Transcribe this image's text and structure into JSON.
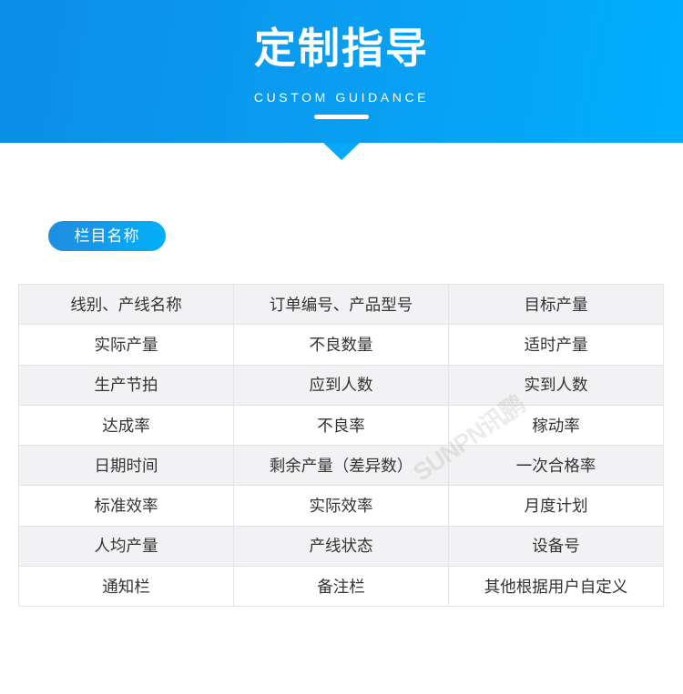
{
  "banner": {
    "title": "定制指导",
    "subtitle": "CUSTOM GUIDANCE",
    "gradient_start": "#0b90e8",
    "gradient_end": "#00aeff",
    "arrow_color": "#07a8fa",
    "text_color": "#ffffff"
  },
  "section": {
    "badge_label": "栏目名称",
    "badge_gradient_start": "#1e8fe0",
    "badge_gradient_end": "#00b0f5"
  },
  "table": {
    "columns": 3,
    "row_shaded_color": "#f2f2f4",
    "row_plain_color": "#ffffff",
    "border_color": "#e3e4e6",
    "text_color": "#333333",
    "rows": [
      [
        "线别、产线名称",
        "订单编号、产品型号",
        "目标产量"
      ],
      [
        "实际产量",
        "不良数量",
        "适时产量"
      ],
      [
        "生产节拍",
        "应到人数",
        "实到人数"
      ],
      [
        "达成率",
        "不良率",
        "稼动率"
      ],
      [
        "日期时间",
        "剩余产量（差异数）",
        "一次合格率"
      ],
      [
        "标准效率",
        "实际效率",
        "月度计划"
      ],
      [
        "人均产量",
        "产线状态",
        "设备号"
      ],
      [
        "通知栏",
        "备注栏",
        "其他根据用户自定义"
      ]
    ]
  },
  "watermark": {
    "text": "SUNPN讯鹏"
  }
}
